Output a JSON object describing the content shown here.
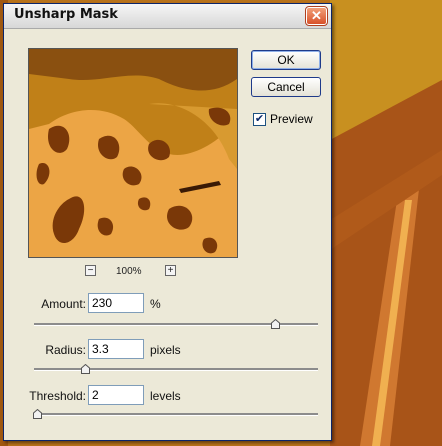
{
  "dialog": {
    "title": "Unsharp Mask",
    "close_glyph": "✕",
    "ok_label": "OK",
    "cancel_label": "Cancel",
    "preview_label": "Preview",
    "preview_checked": true,
    "zoom": {
      "minus": "−",
      "plus": "+",
      "level": "100%"
    },
    "amount": {
      "label": "Amount:",
      "value": "230",
      "unit": "%",
      "slider_fraction": 0.85
    },
    "radius": {
      "label": "Radius:",
      "value": "3.3",
      "unit": "pixels",
      "slider_fraction": 0.18
    },
    "threshold": {
      "label": "Threshold:",
      "value": "2",
      "unit": "levels",
      "slider_fraction": 0.01
    }
  },
  "colors": {
    "background_orange": "#b87018",
    "preview_light": "#e8a040",
    "preview_dark": "#7a3808",
    "dialog_face": "#ece9d8"
  },
  "icons": {
    "close": "close-icon",
    "zoom_out": "zoom-out-icon",
    "zoom_in": "zoom-in-icon",
    "checkmark": "checkmark-icon",
    "slider_thumb": "slider-thumb-icon"
  }
}
